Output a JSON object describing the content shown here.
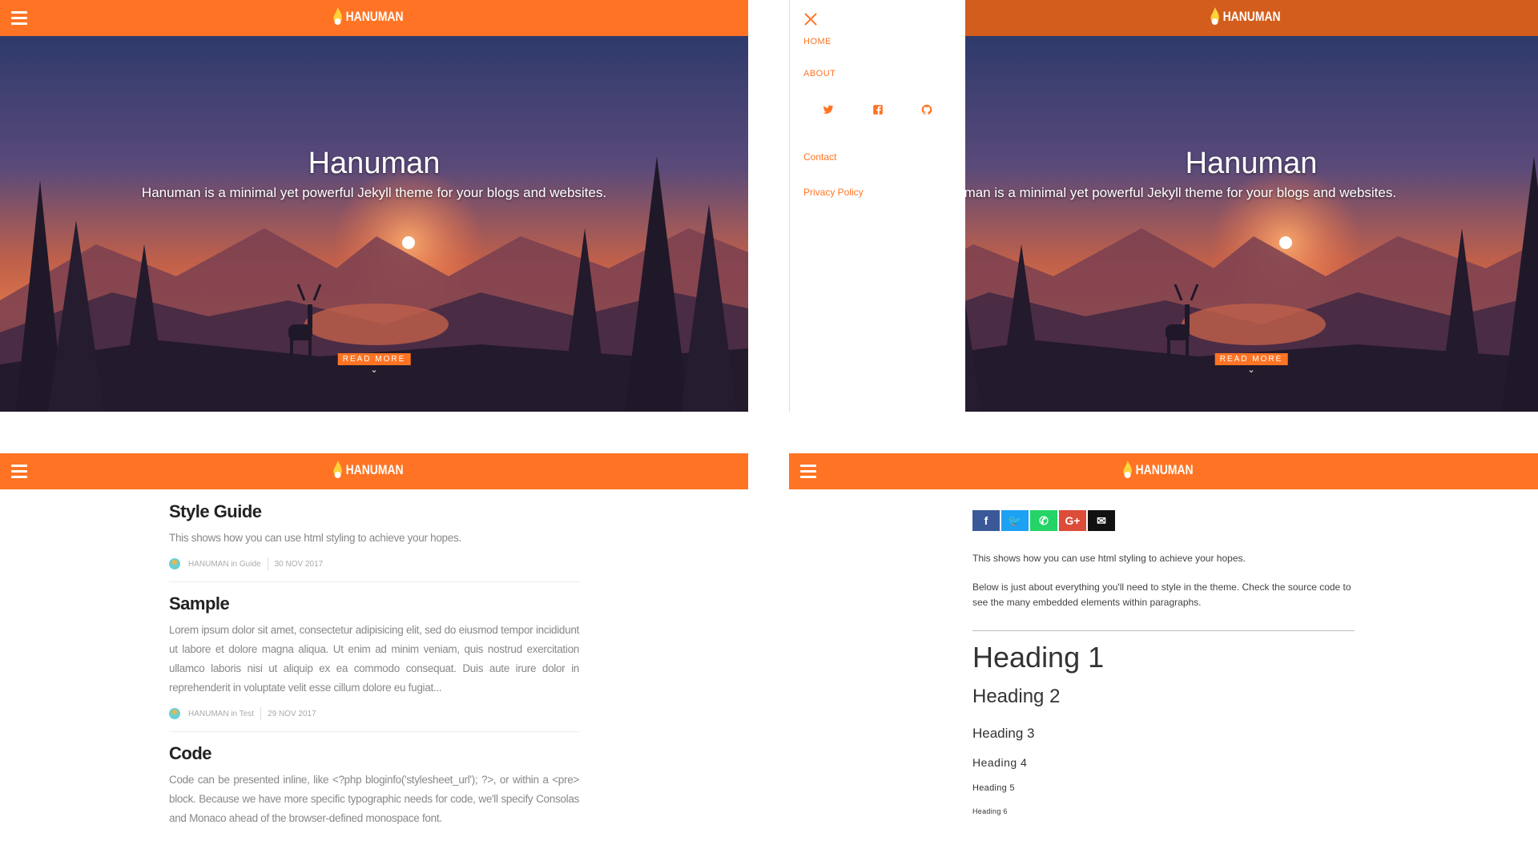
{
  "brand": {
    "name": "HANUMAN",
    "color": "#ff7424"
  },
  "hero": {
    "title": "Hanuman",
    "subtitle": "Hanuman is a minimal yet powerful Jekyll theme for your blogs and websites.",
    "cta": "READ MORE",
    "chevron": "⌄"
  },
  "drawer": {
    "nav": [
      "HOME",
      "ABOUT"
    ],
    "social": [
      "twitter-icon",
      "facebook-icon",
      "github-icon"
    ],
    "links": [
      "Contact",
      "Privacy Policy"
    ]
  },
  "posts": [
    {
      "title": "Style Guide",
      "excerpt": "This shows how you can use html styling to achieve your hopes.",
      "author_line": "HANUMAN in Guide",
      "date": "30 NOV 2017"
    },
    {
      "title": "Sample",
      "excerpt": "Lorem ipsum dolor sit amet, consectetur adipisicing elit, sed do eiusmod tempor incididunt ut labore et dolore magna aliqua. Ut enim ad minim veniam, quis nostrud exercitation ullamco laboris nisi ut aliquip ex ea commodo consequat. Duis aute irure dolor in reprehenderit in voluptate velit esse cillum dolore eu fugiat...",
      "author_line": "HANUMAN in Test",
      "date": "29 NOV 2017"
    },
    {
      "title": "Code",
      "excerpt": "Code can be presented inline, like <?php bloginfo('stylesheet_url'); ?>, or within a <pre> block. Because we have more specific typographic needs for code, we'll specify Consolas and Monaco ahead of the browser-defined monospace font."
    }
  ],
  "article": {
    "share": [
      {
        "icon": "facebook-share-icon",
        "glyph": "f",
        "color": "#3b5998"
      },
      {
        "icon": "twitter-share-icon",
        "glyph": "🐦",
        "color": "#1da1f2"
      },
      {
        "icon": "whatsapp-share-icon",
        "glyph": "✆",
        "color": "#25d366"
      },
      {
        "icon": "google-plus-share-icon",
        "glyph": "G+",
        "color": "#dd4b39"
      },
      {
        "icon": "email-share-icon",
        "glyph": "✉",
        "color": "#111111"
      }
    ],
    "intro": "This shows how you can use html styling to achieve your hopes.",
    "body": "Below is just about everything you'll need to style in the theme. Check the source code to see the many embedded elements within paragraphs.",
    "headings": [
      "Heading 1",
      "Heading 2",
      "Heading 3",
      "Heading 4",
      "Heading 5",
      "Heading 6"
    ]
  }
}
